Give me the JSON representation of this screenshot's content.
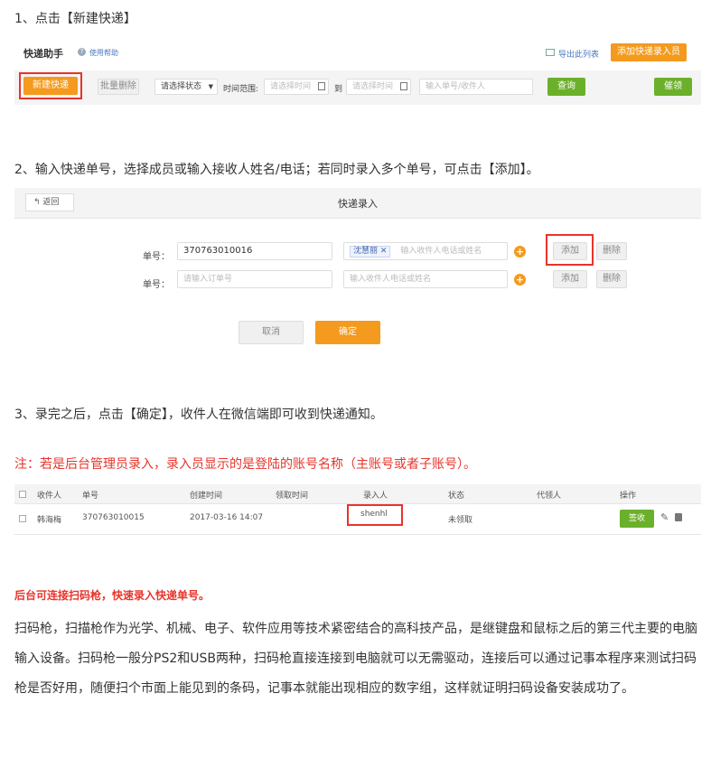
{
  "steps": {
    "s1": "1、点击【新建快递】",
    "s2": "2、输入快递单号，选择成员或输入接收人姓名/电话；若同时录入多个单号，可点击【添加】。",
    "s3": "3、录完之后，点击【确定】，收件人在微信端即可收到快递通知。"
  },
  "panel1": {
    "title": "快递助手",
    "help": "使用帮助",
    "export": "导出此列表",
    "add_member": "添加快递录入员",
    "new_express": "新建快递",
    "batch_delete": "批量删除",
    "status_select": "请选择状态",
    "time_range_label": "时间范围:",
    "start_placeholder": "请选择时间",
    "to": "到",
    "end_placeholder": "请选择时间",
    "search_placeholder": "输入单号/收件人",
    "query": "查询",
    "remind": "催领"
  },
  "panel2": {
    "back": "返回",
    "title": "快递录入",
    "rows": [
      {
        "label": "单号：",
        "value": "370763010016",
        "placeholder": "",
        "tag": "沈慧丽",
        "recipient_placeholder": "输入收件人电话或姓名",
        "add": "添加",
        "del": "删除"
      },
      {
        "label": "单号：",
        "value": "",
        "placeholder": "请输入订单号",
        "tag": "",
        "recipient_placeholder": "输入收件人电话或姓名",
        "add": "添加",
        "del": "删除"
      }
    ],
    "cancel": "取消",
    "confirm": "确定"
  },
  "note": "注：若是后台管理员录入，录入员显示的是登陆的账号名称（主账号或者子账号）。",
  "table": {
    "headers": [
      "收件人",
      "单号",
      "创建时间",
      "领取时间",
      "录入人",
      "状态",
      "代领人",
      "操作"
    ],
    "row": {
      "recipient": "韩海梅",
      "number": "370763010015",
      "created": "2017-03-16 14:07",
      "picked": "",
      "enterer": "shenhl",
      "status": "未领取",
      "proxy": "",
      "sign": "签收"
    }
  },
  "scanner_title": "后台可连接扫码枪，快速录入快递单号。",
  "paragraph": "扫码枪，扫描枪作为光学、机械、电子、软件应用等技术紧密结合的高科技产品，是继键盘和鼠标之后的第三代主要的电脑输入设备。扫码枪一般分PS2和USB两种，扫码枪直接连接到电脑就可以无需驱动，连接后可以通过记事本程序来测试扫码枪是否好用，随便扫个市面上能见到的条码，记事本就能出现相应的数字组，这样就证明扫码设备安装成功了。",
  "colors": {
    "orange": "#f49a1e",
    "green": "#6bb02a",
    "red": "#e8342b"
  }
}
